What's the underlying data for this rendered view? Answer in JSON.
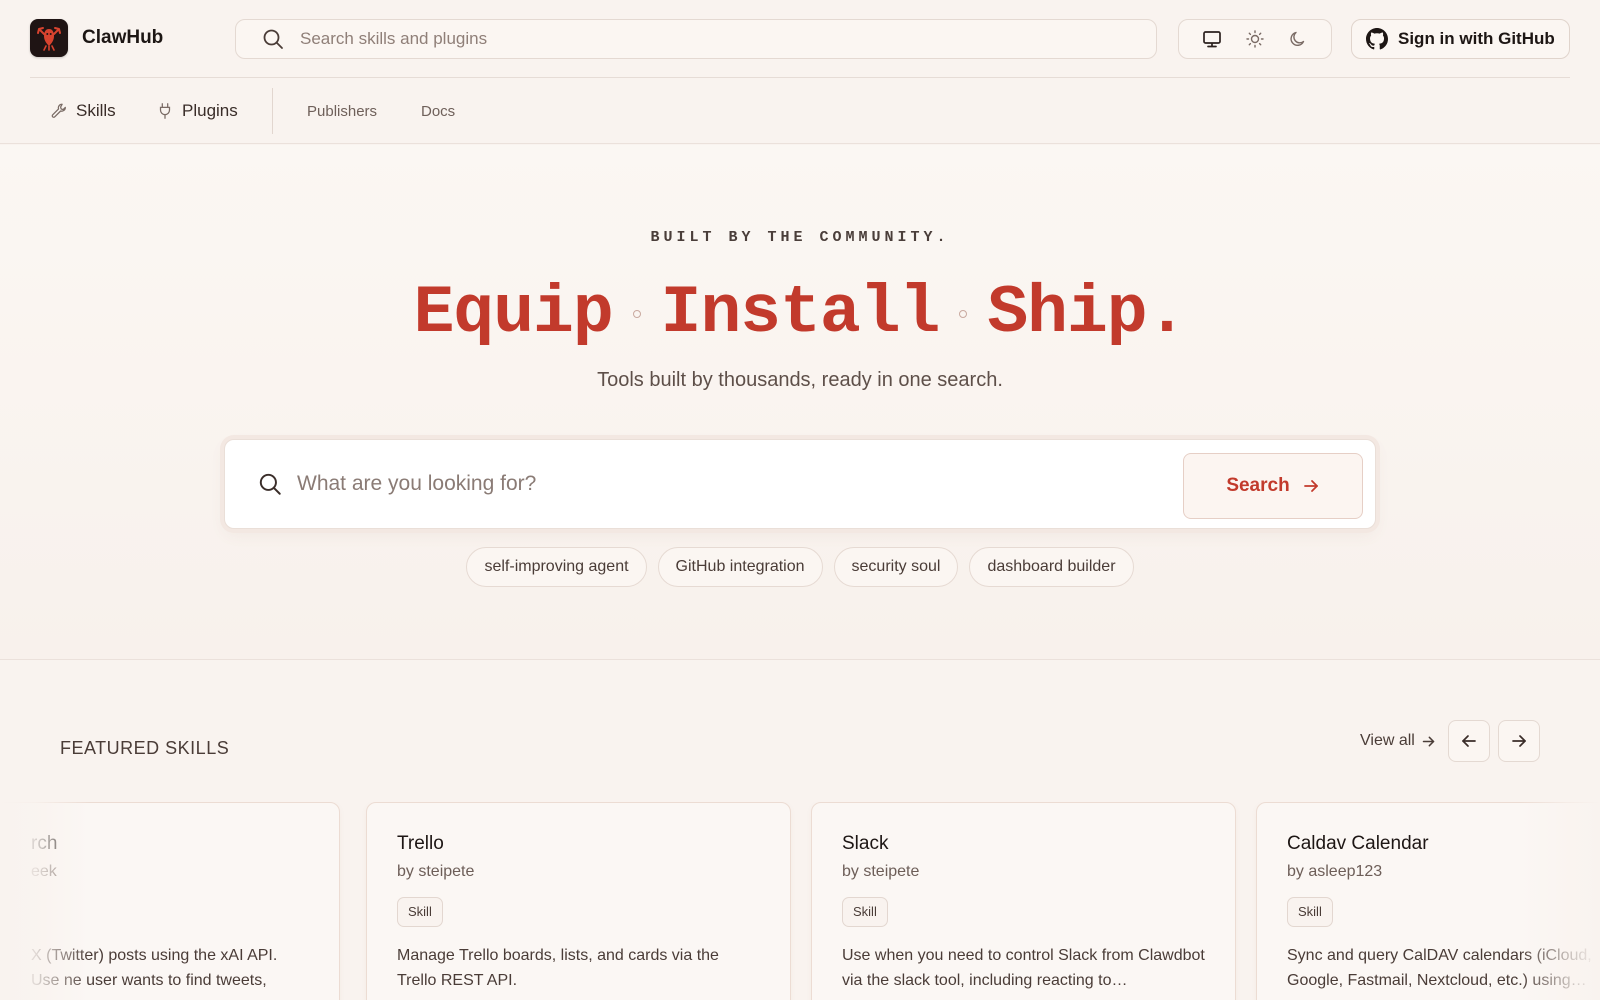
{
  "colors": {
    "accent": "#c23a2c",
    "background": "#f9f3ef",
    "text": "#2b211e"
  },
  "header": {
    "brand": "ClawHub",
    "logo_icon": "lobster-icon",
    "search_placeholder": "Search skills and plugins",
    "theme_options": [
      "monitor-icon",
      "sun-icon",
      "moon-icon"
    ],
    "signin_label": "Sign in with GitHub"
  },
  "nav": {
    "items": [
      {
        "label": "Skills",
        "icon": "wrench-icon"
      },
      {
        "label": "Plugins",
        "icon": "plug-icon"
      },
      {
        "label": "Publishers"
      },
      {
        "label": "Docs"
      }
    ]
  },
  "hero": {
    "eyebrow": "BUILT BY THE COMMUNITY.",
    "headline": [
      "Equip",
      "Install",
      "Ship."
    ],
    "subtitle": "Tools built by thousands, ready in one search.",
    "search_placeholder": "What are you looking for?",
    "search_button": "Search",
    "chips": [
      "self-improving agent",
      "GitHub integration",
      "security soul",
      "dashboard builder"
    ]
  },
  "featured": {
    "title": "FEATURED SKILLS",
    "view_all": "View all",
    "cards": [
      {
        "name": "rch",
        "by": "eek",
        "badge": "",
        "desc": "X (Twitter) posts using the xAI API. Use ne user wants to find tweets, search…"
      },
      {
        "name": "Trello",
        "by": "by steipete",
        "badge": "Skill",
        "desc": "Manage Trello boards, lists, and cards via the Trello REST API."
      },
      {
        "name": "Slack",
        "by": "by steipete",
        "badge": "Skill",
        "desc": "Use when you need to control Slack from Clawdbot via the slack tool, including reacting to…"
      },
      {
        "name": "Caldav Calendar",
        "by": "by asleep123",
        "badge": "Skill",
        "desc": "Sync and query CalDAV calendars (iCloud, Google, Fastmail, Nextcloud, etc.) using…"
      }
    ]
  }
}
